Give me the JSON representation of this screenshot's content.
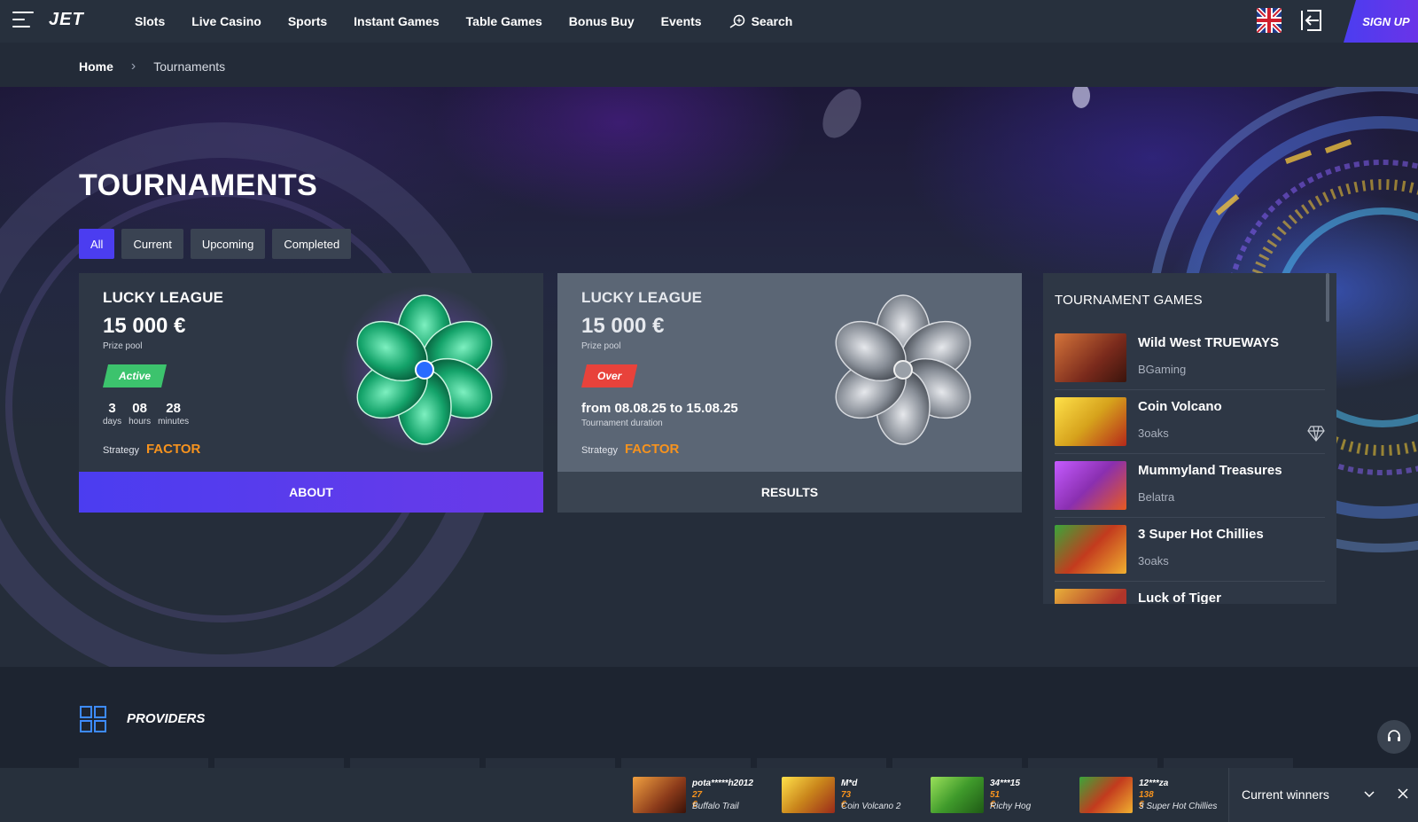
{
  "header": {
    "logo": "JET",
    "nav": [
      "Slots",
      "Live Casino",
      "Sports",
      "Instant Games",
      "Table Games",
      "Bonus Buy",
      "Events"
    ],
    "search_label": "Search",
    "signup_label": "SIGN UP"
  },
  "breadcrumb": {
    "home": "Home",
    "current": "Tournaments"
  },
  "page_title": "TOURNAMENTS",
  "filters": [
    {
      "label": "All",
      "active": true
    },
    {
      "label": "Current",
      "active": false
    },
    {
      "label": "Upcoming",
      "active": false
    },
    {
      "label": "Completed",
      "active": false
    }
  ],
  "tournaments": [
    {
      "name": "LUCKY LEAGUE",
      "prize": "15 000 €",
      "prize_label": "Prize pool",
      "status": "Active",
      "timer": {
        "days": "3",
        "days_label": "days",
        "hours": "08",
        "hours_label": "hours",
        "minutes": "28",
        "minutes_label": "minutes"
      },
      "strategy_label": "Strategy",
      "strategy": "FACTOR",
      "button": "ABOUT"
    },
    {
      "name": "LUCKY LEAGUE",
      "prize": "15 000 €",
      "prize_label": "Prize pool",
      "status": "Over",
      "duration": "from 08.08.25 to 15.08.25",
      "duration_label": "Tournament duration",
      "strategy_label": "Strategy",
      "strategy": "FACTOR",
      "button": "RESULTS"
    }
  ],
  "tournament_games": {
    "title": "TOURNAMENT GAMES",
    "items": [
      {
        "name": "Wild West TRUEWAYS",
        "provider": "BGaming",
        "thumb_color": "#7a2a1c"
      },
      {
        "name": "Coin Volcano",
        "provider": "3oaks",
        "thumb_color": "#d6a21c"
      },
      {
        "name": "Mummyland Treasures",
        "provider": "Belatra",
        "thumb_color": "#8a2fb0"
      },
      {
        "name": "3 Super Hot Chillies",
        "provider": "3oaks",
        "thumb_color": "#c33b1e"
      },
      {
        "name": "Luck of Tiger",
        "provider": "",
        "thumb_color": "#b0352a"
      }
    ]
  },
  "providers": {
    "title": "PROVIDERS"
  },
  "winners": {
    "label": "Current winners",
    "items": [
      {
        "user": "pota*****h2012",
        "amount": "27 €",
        "game": "Buffalo Trail",
        "thumb_color": "#8b3a1a"
      },
      {
        "user": "M*d",
        "amount": "73 €",
        "game": "Coin Volcano 2",
        "thumb_color": "#c9851b"
      },
      {
        "user": "34***15",
        "amount": "51 €",
        "game": "Richy Hog",
        "thumb_color": "#3f9a2b"
      },
      {
        "user": "12***za",
        "amount": "138 €",
        "game": "3 Super Hot Chillies",
        "thumb_color": "#c33b1e"
      }
    ]
  },
  "colors": {
    "accent": "#4b3df0",
    "orange": "#f7931e",
    "active": "#3cc36d",
    "over": "#e8423b"
  }
}
